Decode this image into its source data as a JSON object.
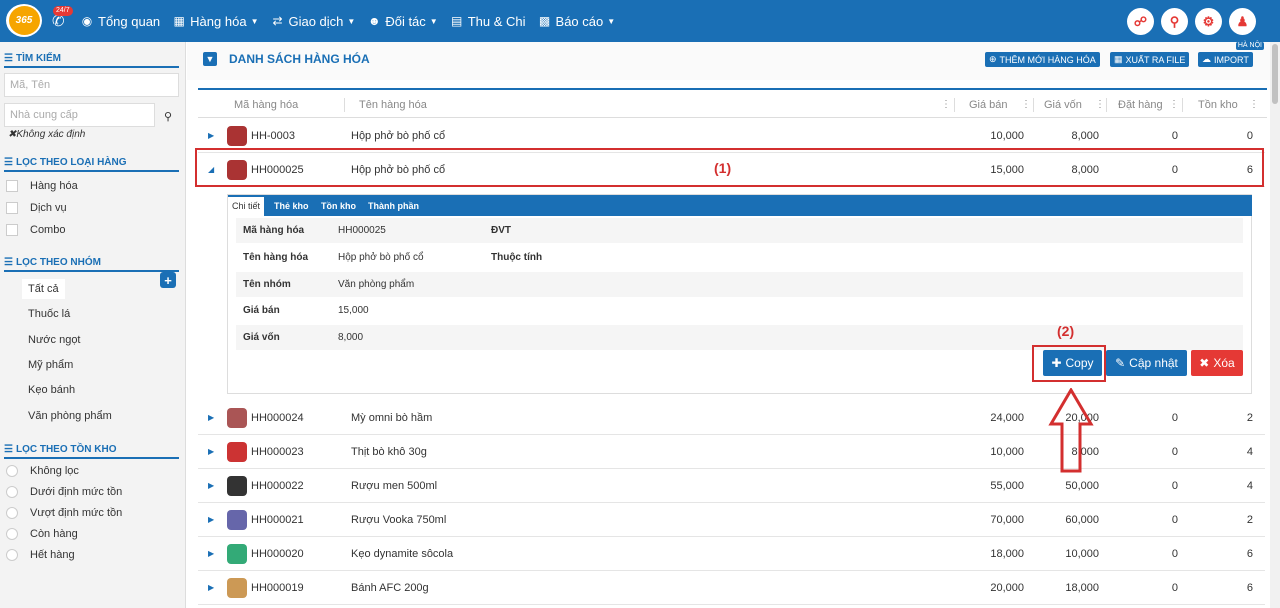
{
  "topbar": {
    "logo_text": "365",
    "hotline_badge": "24/7",
    "menu": [
      {
        "label": "Tổng quan",
        "icon": "dashboard-icon",
        "caret": false
      },
      {
        "label": "Hàng hóa",
        "icon": "cubes-icon",
        "caret": true
      },
      {
        "label": "Giao dịch",
        "icon": "exchange-icon",
        "caret": true
      },
      {
        "label": "Đối tác",
        "icon": "users-icon",
        "caret": true
      },
      {
        "label": "Thu & Chi",
        "icon": "money-icon",
        "caret": false
      },
      {
        "label": "Báo cáo",
        "icon": "chart-icon",
        "caret": true
      }
    ],
    "right_icons": [
      "cart-icon",
      "location-icon",
      "gear-icon",
      "user-icon"
    ]
  },
  "sidebar": {
    "search_title": "TÌM KIẾM",
    "search_placeholder": "Mã, Tên",
    "supplier_placeholder": "Nhà cung cấp",
    "undefined_label": "✖Không xác định",
    "type_title": "LỌC THEO LOẠI HÀNG",
    "types": [
      "Hàng hóa",
      "Dịch vụ",
      "Combo"
    ],
    "group_title": "LỌC THEO NHÓM",
    "groups": [
      "Tất cả",
      "Thuốc lá",
      "Nước ngọt",
      "Mỹ phẩm",
      "Kẹo bánh",
      "Văn phòng phẩm"
    ],
    "stock_title": "LỌC THEO TỒN KHO",
    "stock_filters": [
      "Không lọc",
      "Dưới định mức tồn",
      "Vượt định mức tồn",
      "Còn hàng",
      "Hết hàng"
    ]
  },
  "main": {
    "title": "DANH SÁCH HÀNG HÓA",
    "btn_add": "THÊM MỚI HÀNG HÓA",
    "btn_export": "XUẤT RA FILE",
    "btn_import": "IMPORT",
    "location_badge": "HÀ NỘI",
    "columns": [
      "Mã hàng hóa",
      "Tên hàng hóa",
      "Giá bán",
      "Giá vốn",
      "Đặt hàng",
      "Tồn kho"
    ],
    "rows": [
      {
        "code": "HH-0003",
        "name": "Hộp phở bò phố cổ",
        "price": "10,000",
        "cost": "8,000",
        "order": "0",
        "stock": "0"
      },
      {
        "code": "HH000025",
        "name": "Hộp phở bò phố cổ",
        "price": "15,000",
        "cost": "8,000",
        "order": "0",
        "stock": "6"
      },
      {
        "code": "HH000024",
        "name": "Mỳ omni bò hầm",
        "price": "24,000",
        "cost": "20,000",
        "order": "0",
        "stock": "2"
      },
      {
        "code": "HH000023",
        "name": "Thịt bò khô 30g",
        "price": "10,000",
        "cost": "8,000",
        "order": "0",
        "stock": "4"
      },
      {
        "code": "HH000022",
        "name": "Rượu men 500ml",
        "price": "55,000",
        "cost": "50,000",
        "order": "0",
        "stock": "4"
      },
      {
        "code": "HH000021",
        "name": "Rượu Vooka 750ml",
        "price": "70,000",
        "cost": "60,000",
        "order": "0",
        "stock": "2"
      },
      {
        "code": "HH000020",
        "name": "Kẹo dynamite sôcola",
        "price": "18,000",
        "cost": "10,000",
        "order": "0",
        "stock": "6"
      },
      {
        "code": "HH000019",
        "name": "Bánh AFC 200g",
        "price": "20,000",
        "cost": "18,000",
        "order": "0",
        "stock": "6"
      }
    ],
    "annotation_1": "(1)",
    "annotation_2": "(2)"
  },
  "detail": {
    "tabs": [
      "Chi tiết",
      "Thẻ kho",
      "Tồn kho",
      "Thành phần"
    ],
    "fields": [
      {
        "key": "Mã hàng hóa",
        "value": "HH000025",
        "key2": "ĐVT"
      },
      {
        "key": "Tên hàng hóa",
        "value": "Hộp phở bò phố cổ",
        "key2": "Thuộc tính"
      },
      {
        "key": "Tên nhóm",
        "value": "Văn phòng phẩm",
        "key2": ""
      },
      {
        "key": "Giá bán",
        "value": "15,000",
        "key2": ""
      },
      {
        "key": "Giá vốn",
        "value": "8,000",
        "key2": ""
      }
    ],
    "btn_copy": "Copy",
    "btn_update": "Cập nhật",
    "btn_delete": "Xóa"
  },
  "colors": {
    "primary": "#1a6fb5",
    "danger": "#e53935",
    "annotation": "#d32f2f"
  }
}
